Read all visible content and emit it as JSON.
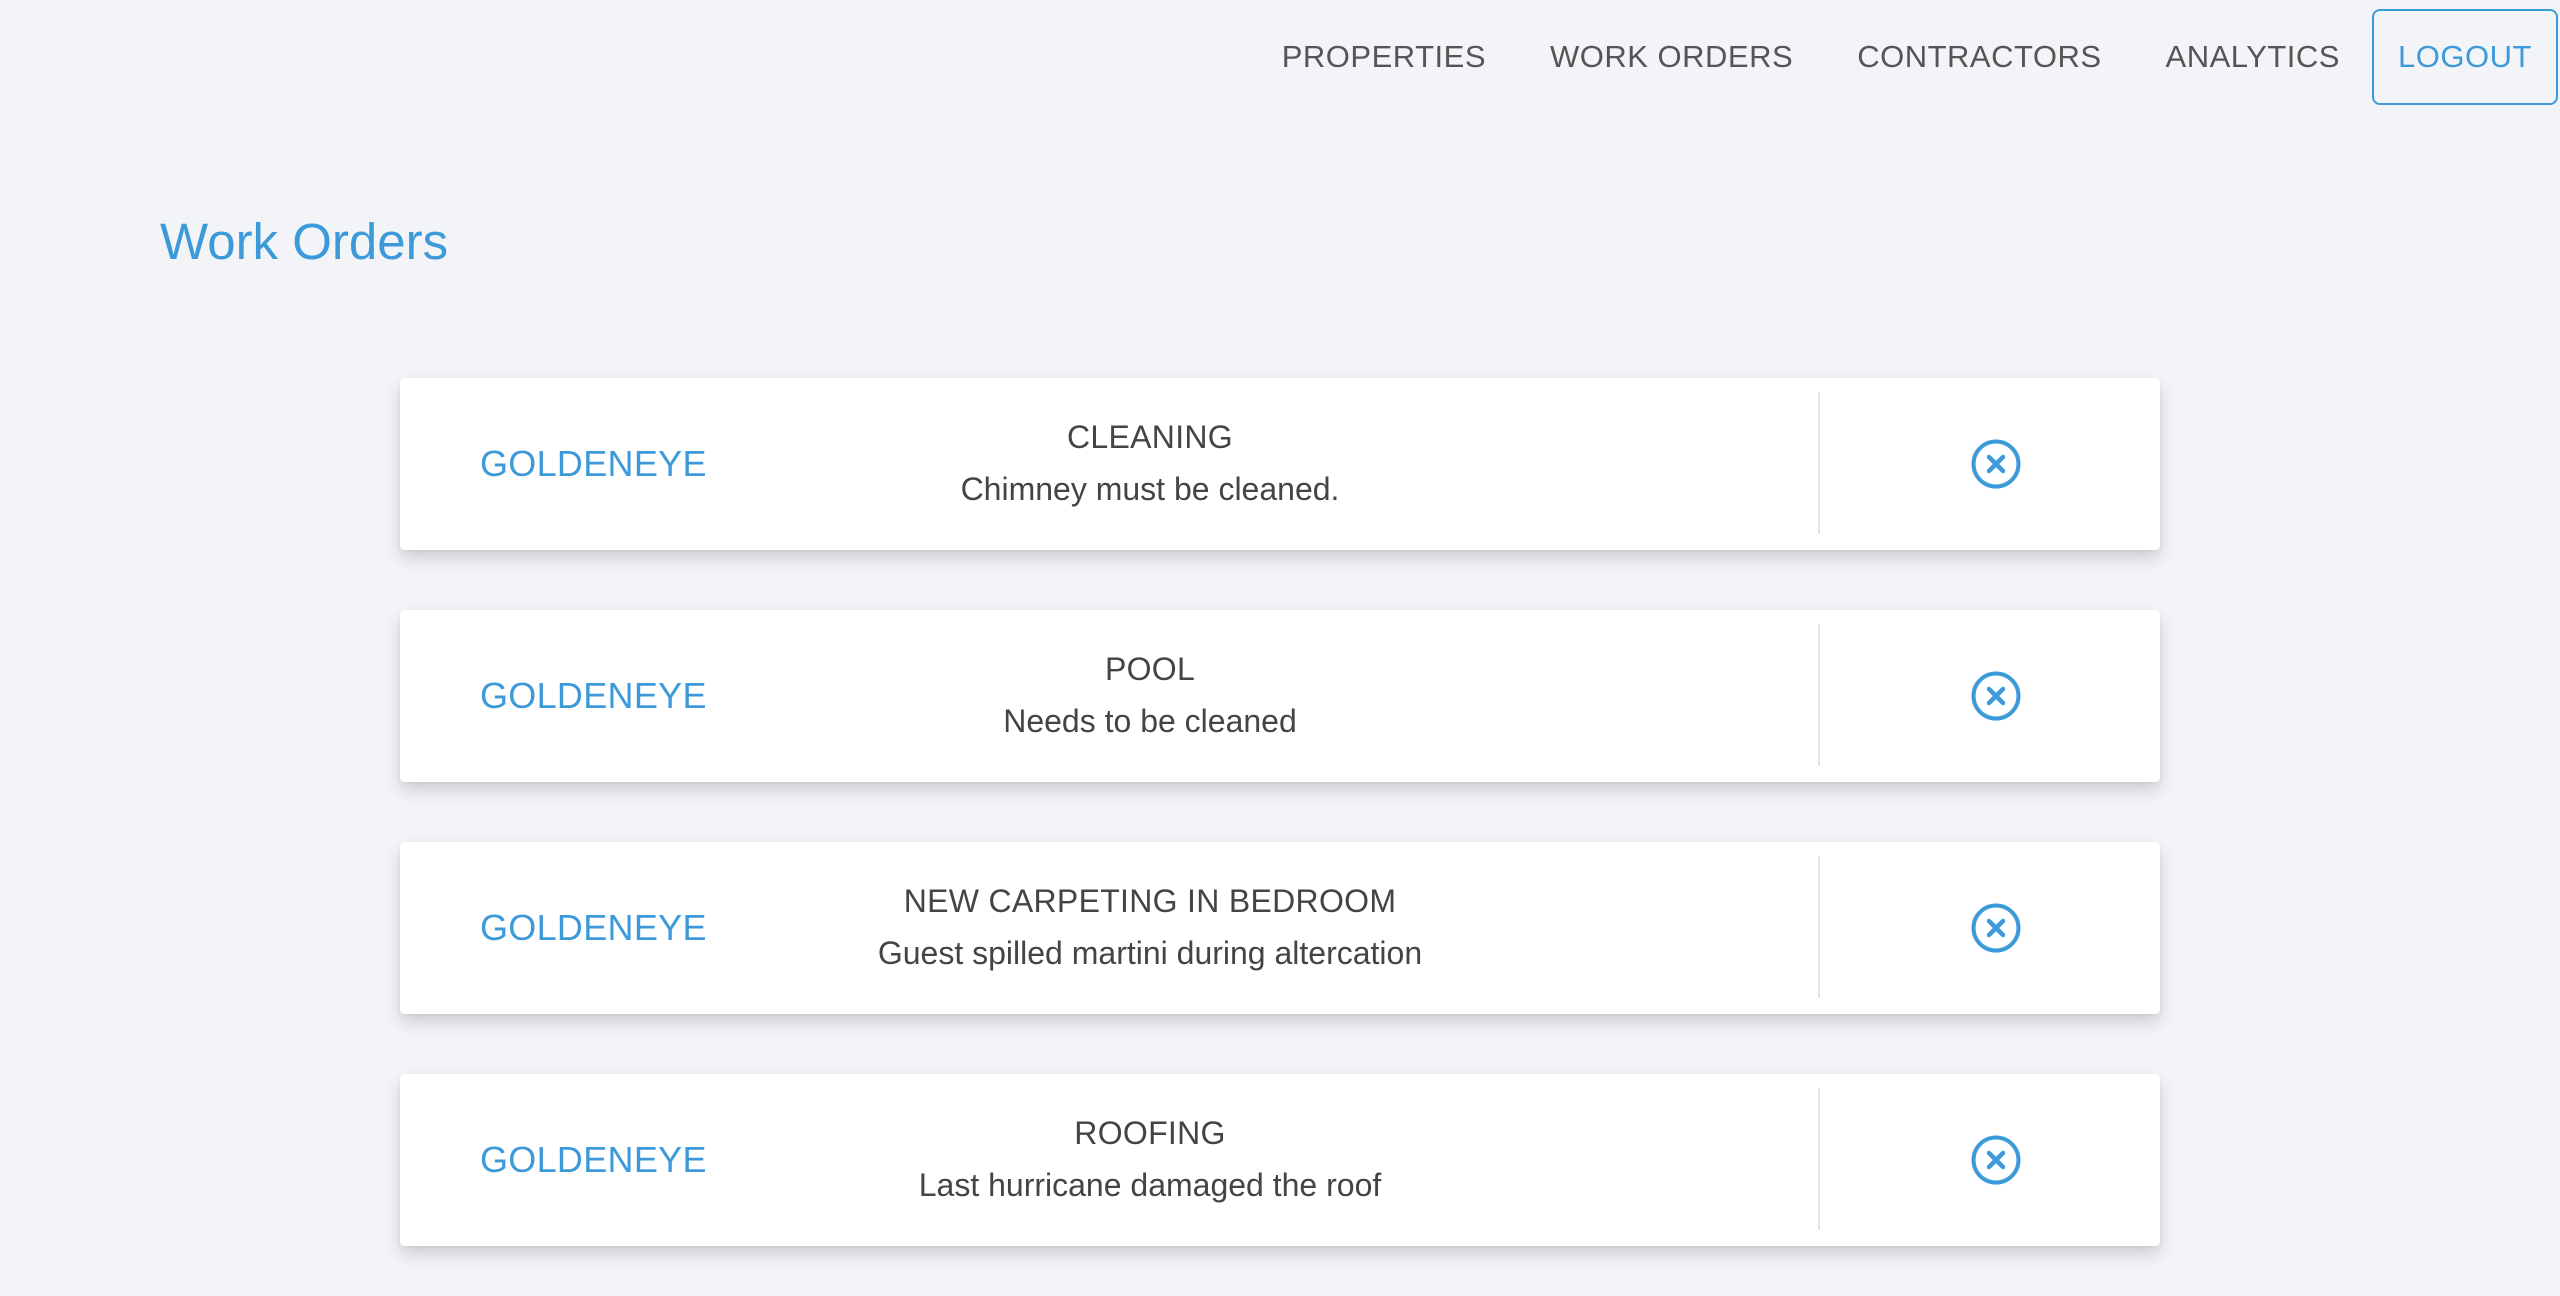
{
  "nav": {
    "links": [
      "PROPERTIES",
      "WORK ORDERS",
      "CONTRACTORS",
      "ANALYTICS"
    ],
    "logout_label": "LOGOUT"
  },
  "page_title": "Work Orders",
  "orders": [
    {
      "property": "GOLDENEYE",
      "type": "CLEANING",
      "description": "Chimney must be cleaned."
    },
    {
      "property": "GOLDENEYE",
      "type": "POOL",
      "description": "Needs to be cleaned"
    },
    {
      "property": "GOLDENEYE",
      "type": "NEW CARPETING IN BEDROOM",
      "description": "Guest spilled martini during altercation"
    },
    {
      "property": "GOLDENEYE",
      "type": "ROOFING",
      "description": "Last hurricane damaged the roof"
    }
  ],
  "icons": {
    "remove": "close-circle-icon"
  },
  "colors": {
    "accent": "#3d9ad9",
    "background": "#f3f4f8",
    "card": "#ffffff",
    "text": "#444444",
    "nav_text": "#555555"
  }
}
